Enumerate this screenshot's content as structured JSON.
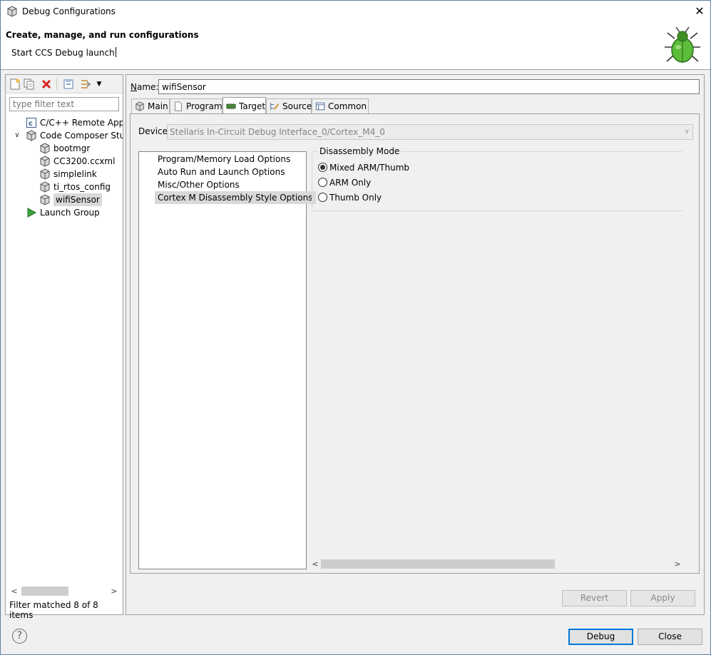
{
  "window": {
    "title": "Debug Configurations",
    "close_glyph": "✕",
    "icon": "debug-config-icon"
  },
  "banner": {
    "heading": "Create, manage, and run configurations",
    "message": "Start CCS Debug launch",
    "image": "green-bug-icon"
  },
  "left": {
    "toolbar": [
      {
        "name": "new-config-button",
        "icon": "new-document-icon"
      },
      {
        "name": "duplicate-button",
        "icon": "duplicate-icon"
      },
      {
        "name": "delete-button",
        "icon": "red-x-icon"
      },
      {
        "name": "collapse-all-button",
        "icon": "collapse-all-icon"
      },
      {
        "name": "filter-button",
        "icon": "filter-icon"
      }
    ],
    "filter_placeholder": "type filter text",
    "tree": [
      {
        "label": "C/C++ Remote Appli",
        "level": 1,
        "icon": "c-app-icon"
      },
      {
        "label": "Code Composer Stuc",
        "level": 1,
        "icon": "ccs-cube-icon",
        "expanded": true
      },
      {
        "label": "bootmgr",
        "level": 2,
        "icon": "ccs-cube-icon"
      },
      {
        "label": "CC3200.ccxml",
        "level": 2,
        "icon": "ccs-cube-icon"
      },
      {
        "label": "simplelink",
        "level": 2,
        "icon": "ccs-cube-icon"
      },
      {
        "label": "ti_rtos_config",
        "level": 2,
        "icon": "ccs-cube-icon"
      },
      {
        "label": "wifiSensor",
        "level": 2,
        "icon": "ccs-cube-icon",
        "selected": true
      },
      {
        "label": "Launch Group",
        "level": 1,
        "icon": "launch-group-icon"
      }
    ],
    "status": "Filter matched 8 of 8 items"
  },
  "right": {
    "name_label": "ame:",
    "name_label_mnemonic": "N",
    "name_value": "wifiSensor",
    "tabs": [
      {
        "label": "Main",
        "icon": "main-tab-icon"
      },
      {
        "label": "Program",
        "icon": "program-tab-icon"
      },
      {
        "label": "Target",
        "icon": "target-tab-icon",
        "active": true
      },
      {
        "label": "Source",
        "icon": "source-tab-icon"
      },
      {
        "label": "Common",
        "icon": "common-tab-icon"
      }
    ],
    "device_label": "Device",
    "device_value": "Stellaris In-Circuit Debug Interface_0/Cortex_M4_0",
    "option_list": [
      "Program/Memory Load Options",
      "Auto Run and Launch Options",
      "Misc/Other Options",
      "Cortex M Disassembly Style Options"
    ],
    "option_selected": "Cortex M Disassembly Style Options",
    "group_title": "Disassembly Mode",
    "radios": [
      {
        "label": "Mixed ARM/Thumb",
        "checked": true
      },
      {
        "label": "ARM Only",
        "checked": false
      },
      {
        "label": "Thumb Only",
        "checked": false
      }
    ],
    "revert_label": "Revert",
    "apply_label": "Apply"
  },
  "footer": {
    "help_glyph": "?",
    "debug_label": "Debug",
    "close_label": "Close"
  }
}
